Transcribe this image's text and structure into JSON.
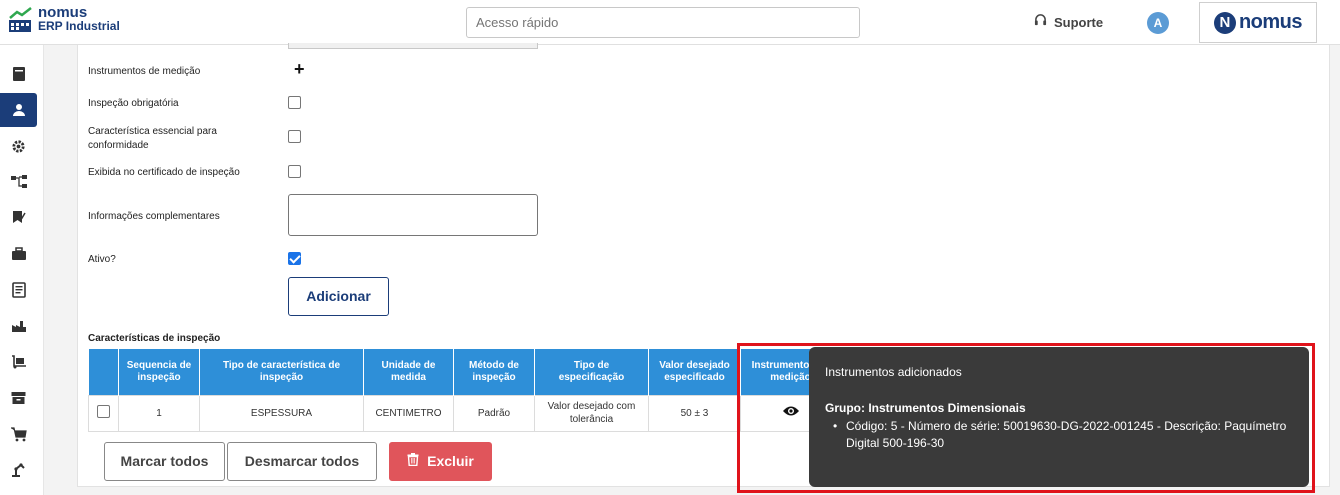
{
  "header": {
    "logo_line1": "nomus",
    "logo_line2": "ERP Industrial",
    "search_placeholder": "Acesso rápido",
    "support_label": "Suporte",
    "avatar_initial": "A",
    "brand_letter": "N",
    "brand_word": "nomus"
  },
  "sidebar": {
    "items": [
      {
        "icon": "book-icon"
      },
      {
        "icon": "user-icon",
        "active": true
      },
      {
        "icon": "gear-icon"
      },
      {
        "icon": "flow-icon"
      },
      {
        "icon": "flag-check-icon"
      },
      {
        "icon": "briefcase-icon"
      },
      {
        "icon": "document-icon"
      },
      {
        "icon": "factory-icon"
      },
      {
        "icon": "dolly-icon"
      },
      {
        "icon": "archive-icon"
      },
      {
        "icon": "cart-icon"
      },
      {
        "icon": "robot-arm-icon"
      }
    ]
  },
  "form": {
    "instruments_label": "Instrumentos de medição",
    "add_instrument_symbol": "+",
    "inspection_required_label": "Inspeção obrigatória",
    "inspection_required": false,
    "essential_label": "Característica essencial para conformidade",
    "essential": false,
    "shown_in_cert_label": "Exibida no certificado de inspeção",
    "shown_in_cert": false,
    "complementary_label": "Informações complementares",
    "complementary_value": "",
    "active_label": "Ativo?",
    "active": true,
    "add_button": "Adicionar"
  },
  "table": {
    "title": "Características de inspeção",
    "headers": [
      "",
      "Sequencia de inspeção",
      "Tipo de característica de inspeção",
      "Unidade de medida",
      "Método de inspeção",
      "Tipo de especificação",
      "Valor desejado especificado",
      "Instrumentos de medição"
    ],
    "rows": [
      {
        "selected": false,
        "sequence": "1",
        "characteristic_type": "ESPESSURA",
        "unit": "CENTIMETRO",
        "method": "Padrão",
        "spec_type": "Valor desejado com tolerância",
        "value": "50 ± 3",
        "instruments_icon": "eye-icon"
      }
    ]
  },
  "actions": {
    "mark_all": "Marcar todos",
    "unmark_all": "Desmarcar todos",
    "delete": "Excluir"
  },
  "tooltip": {
    "title": "Instrumentos adicionados",
    "group": "Grupo: Instrumentos Dimensionais",
    "item": "Código: 5 - Número de série: 50019630-DG-2022-001245 - Descrição: Paquímetro Digital 500-196-30"
  },
  "colors": {
    "brand": "#1b3d79",
    "table_header": "#2e8fd8",
    "danger": "#e0555b",
    "highlight": "#e0131b",
    "tooltip_bg": "#3a3a3a"
  }
}
